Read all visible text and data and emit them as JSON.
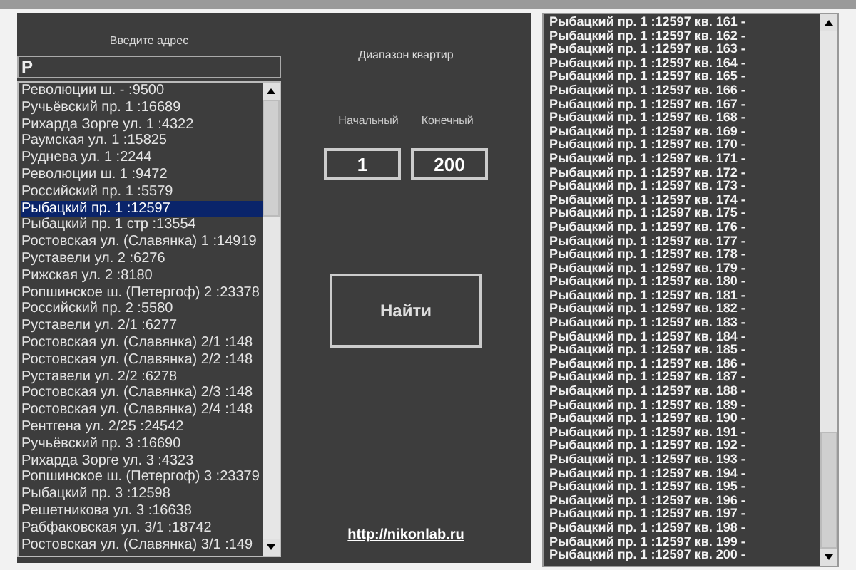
{
  "address_label": "Введите адрес",
  "address_field": {
    "value": "Р"
  },
  "addresses": [
    {
      "text": "Революции ш. - :9500",
      "selected": false
    },
    {
      "text": "Ручьёвский пр. 1 :16689",
      "selected": false
    },
    {
      "text": "Рихарда Зорге ул. 1 :4322",
      "selected": false
    },
    {
      "text": "Раумская ул. 1 :15825",
      "selected": false
    },
    {
      "text": "Руднева ул. 1 :2244",
      "selected": false
    },
    {
      "text": "Революции ш. 1 :9472",
      "selected": false
    },
    {
      "text": "Российский пр. 1 :5579",
      "selected": false
    },
    {
      "text": "Рыбацкий пр. 1 :12597",
      "selected": true
    },
    {
      "text": "Рыбацкий пр. 1 стр :13554",
      "selected": false
    },
    {
      "text": "Ростовская ул. (Славянка) 1 :14919",
      "selected": false
    },
    {
      "text": "Руставели ул. 2 :6276",
      "selected": false
    },
    {
      "text": "Рижская ул. 2 :8180",
      "selected": false
    },
    {
      "text": "Ропшинское ш. (Петергоф) 2 :23378",
      "selected": false
    },
    {
      "text": "Российский пр. 2 :5580",
      "selected": false
    },
    {
      "text": "Руставели ул. 2/1 :6277",
      "selected": false
    },
    {
      "text": "Ростовская ул. (Славянка) 2/1 :148",
      "selected": false
    },
    {
      "text": "Ростовская ул. (Славянка) 2/2 :148",
      "selected": false
    },
    {
      "text": "Руставели ул. 2/2 :6278",
      "selected": false
    },
    {
      "text": "Ростовская ул. (Славянка) 2/3 :148",
      "selected": false
    },
    {
      "text": "Ростовская ул. (Славянка) 2/4 :148",
      "selected": false
    },
    {
      "text": "Рентгена ул. 2/25 :24542",
      "selected": false
    },
    {
      "text": "Ручьёвский пр. 3 :16690",
      "selected": false
    },
    {
      "text": "Рихарда Зорге ул. 3 :4323",
      "selected": false
    },
    {
      "text": "Ропшинское ш. (Петергоф) 3 :23379",
      "selected": false
    },
    {
      "text": "Рыбацкий пр. 3 :12598",
      "selected": false
    },
    {
      "text": "Решетникова ул. 3 :16638",
      "selected": false
    },
    {
      "text": "Рабфаковская ул. 3/1 :18742",
      "selected": false
    },
    {
      "text": "Ростовская ул. (Славянка) 3/1 :149",
      "selected": false
    }
  ],
  "range_title": "Диапазон квартир",
  "start_label": "Начальный",
  "end_label": "Конечный",
  "start_field": {
    "value": "1"
  },
  "end_field": {
    "value": "200"
  },
  "find_button": "Найти",
  "link": "http://nikonlab.ru",
  "results": [
    "Рыбацкий пр. 1 :12597 кв. 161 -",
    "Рыбацкий пр. 1 :12597 кв. 162 -",
    "Рыбацкий пр. 1 :12597 кв. 163 -",
    "Рыбацкий пр. 1 :12597 кв. 164 -",
    "Рыбацкий пр. 1 :12597 кв. 165 -",
    "Рыбацкий пр. 1 :12597 кв. 166 -",
    "Рыбацкий пр. 1 :12597 кв. 167 -",
    "Рыбацкий пр. 1 :12597 кв. 168 -",
    "Рыбацкий пр. 1 :12597 кв. 169 -",
    "Рыбацкий пр. 1 :12597 кв. 170 -",
    "Рыбацкий пр. 1 :12597 кв. 171 -",
    "Рыбацкий пр. 1 :12597 кв. 172 -",
    "Рыбацкий пр. 1 :12597 кв. 173 -",
    "Рыбацкий пр. 1 :12597 кв. 174 -",
    "Рыбацкий пр. 1 :12597 кв. 175 -",
    "Рыбацкий пр. 1 :12597 кв. 176 -",
    "Рыбацкий пр. 1 :12597 кв. 177 -",
    "Рыбацкий пр. 1 :12597 кв. 178 -",
    "Рыбацкий пр. 1 :12597 кв. 179 -",
    "Рыбацкий пр. 1 :12597 кв. 180 -",
    "Рыбацкий пр. 1 :12597 кв. 181 -",
    "Рыбацкий пр. 1 :12597 кв. 182 -",
    "Рыбацкий пр. 1 :12597 кв. 183 -",
    "Рыбацкий пр. 1 :12597 кв. 184 -",
    "Рыбацкий пр. 1 :12597 кв. 185 -",
    "Рыбацкий пр. 1 :12597 кв. 186 -",
    "Рыбацкий пр. 1 :12597 кв. 187 -",
    "Рыбацкий пр. 1 :12597 кв. 188 -",
    "Рыбацкий пр. 1 :12597 кв. 189 -",
    "Рыбацкий пр. 1 :12597 кв. 190 -",
    "Рыбацкий пр. 1 :12597 кв. 191 -",
    "Рыбацкий пр. 1 :12597 кв. 192 -",
    "Рыбацкий пр. 1 :12597 кв. 193 -",
    "Рыбацкий пр. 1 :12597 кв. 194 -",
    "Рыбацкий пр. 1 :12597 кв. 195 -",
    "Рыбацкий пр. 1 :12597 кв. 196 -",
    "Рыбацкий пр. 1 :12597 кв. 197 -",
    "Рыбацкий пр. 1 :12597 кв. 198 -",
    "Рыбацкий пр. 1 :12597 кв. 199 -",
    "Рыбацкий пр. 1 :12597 кв. 200 -"
  ]
}
